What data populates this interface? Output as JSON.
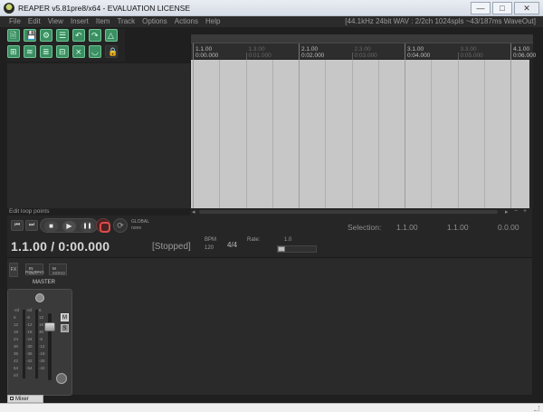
{
  "window": {
    "title": "REAPER v5.81pre8/x64 - EVALUATION LICENSE",
    "buttons": {
      "minimize": "—",
      "maximize": "□",
      "close": "✕"
    }
  },
  "menu": {
    "items": [
      "File",
      "Edit",
      "View",
      "Insert",
      "Item",
      "Track",
      "Options",
      "Actions",
      "Help"
    ],
    "status": "[44.1kHz 24bit WAV : 2/2ch 1024spls ~43/187ms WaveOut]"
  },
  "toolbar": {
    "icons": [
      {
        "name": "new-project-icon",
        "glyph": "🗎",
        "on": true
      },
      {
        "name": "save-project-icon",
        "glyph": "💾",
        "on": true
      },
      {
        "name": "project-settings-icon",
        "glyph": "⚙",
        "on": true
      },
      {
        "name": "track-manager-icon",
        "glyph": "☰",
        "on": true
      },
      {
        "name": "undo-icon",
        "glyph": "↶",
        "on": true
      },
      {
        "name": "redo-icon",
        "glyph": "↷",
        "on": true
      },
      {
        "name": "metronome-icon",
        "glyph": "△",
        "on": true
      },
      {
        "name": "snap-icon",
        "glyph": "⊞",
        "on": true
      },
      {
        "name": "ripple-edit-icon",
        "glyph": "≋",
        "on": true
      },
      {
        "name": "ripple-all-icon",
        "glyph": "≣",
        "on": true
      },
      {
        "name": "grid-icon",
        "glyph": "⊟",
        "on": true
      },
      {
        "name": "auto-crossfade-icon",
        "glyph": "⨯",
        "on": true
      },
      {
        "name": "envelope-lock-icon",
        "glyph": "◡",
        "on": true
      },
      {
        "name": "lock-icon",
        "glyph": "🔒",
        "on": false
      }
    ]
  },
  "tcp_caption": "Edit loop points",
  "ruler": {
    "major": [
      "1.1.00",
      "2.1.00",
      "3.1.00",
      "4.1.00"
    ],
    "major_times": [
      "0:00.000",
      "0:02.000",
      "0:04.000",
      "0:06.000"
    ],
    "minor": [
      "1.3.00",
      "2.3.00",
      "3.3.00"
    ],
    "minor_times": [
      "0:01.000",
      "0:03.000",
      "0:05.000"
    ]
  },
  "transport": {
    "buttons": {
      "go_start": "⏮",
      "go_end": "⏭",
      "stop": "■",
      "play": "▶",
      "pause": "❚❚",
      "repeat": "⟳"
    },
    "global_label": "GLOBAL",
    "global_sub": "none",
    "time": "1.1.00 / 0:00.000",
    "state": "[Stopped]",
    "bpm_label": "BPM",
    "bpm": "120",
    "time_signature": "4/4",
    "rate_label": "Rate:",
    "rate": "1.0",
    "rate_position": 0.0,
    "selection_label": "Selection:",
    "selection_start": "1.1.00",
    "selection_end": "1.1.00",
    "selection_length": "0.0.00"
  },
  "mixer": {
    "fx_label": "FX",
    "routing_label": "ROUTING",
    "io_top": "IN",
    "io_bottom": "OUT",
    "mono_top": "M",
    "mono_bottom": "MONO",
    "master_label": "MASTER",
    "mute_label": "M",
    "solo_label": "S",
    "meter_scale_left": [
      "-inf",
      "6",
      "12",
      "18",
      "24",
      "30",
      "36",
      "42",
      "54",
      "inf"
    ],
    "meter_scale_right": [
      "-inf",
      "-6",
      "-12",
      "-18",
      "-24",
      "-30",
      "-36",
      "-42",
      "-54"
    ],
    "meter_scale_fader": [
      "6",
      "12",
      "18",
      "30",
      "-6",
      "-12",
      "-18",
      "-30",
      "-42"
    ],
    "tab": "Mixer"
  }
}
